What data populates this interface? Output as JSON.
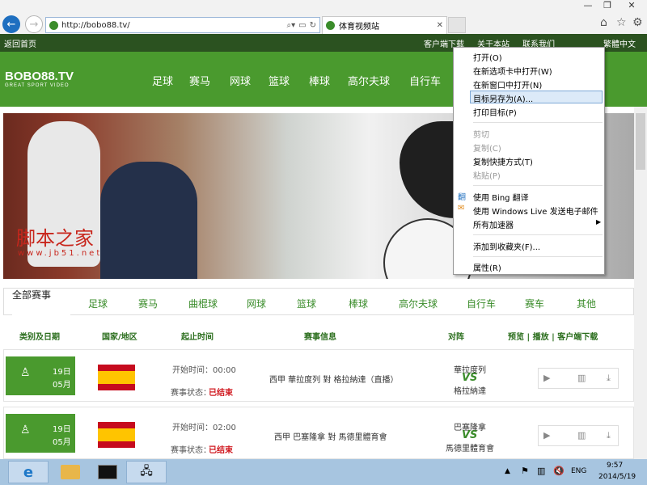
{
  "browser": {
    "url": "http://bobo88.tv/",
    "tab_title": "体育视频站",
    "fav_icon": "site-leaf-icon"
  },
  "topbar": {
    "home": "返回首页",
    "download": "客户端下载",
    "about": "关于本站",
    "contact": "联系我们",
    "lang": "繁體中文"
  },
  "site": {
    "logo": "BOBO88.TV",
    "slogan": "GREAT SPORT VIDEO",
    "nav": [
      "足球",
      "赛马",
      "网球",
      "篮球",
      "棒球",
      "高尔夫球",
      "自行车"
    ]
  },
  "banner": {
    "watermark": "脚本之家",
    "watermark_url": "www.jb51.net"
  },
  "tabs": [
    "全部赛事",
    "足球",
    "赛马",
    "曲棍球",
    "网球",
    "篮球",
    "棒球",
    "高尔夫球",
    "自行车",
    "赛车",
    "其他"
  ],
  "headers": {
    "date": "类别及日期",
    "country": "国家/地区",
    "time": "起止时间",
    "info": "赛事信息",
    "match": "对阵",
    "actions": "预览 | 播放 | 客户端下载"
  },
  "rows": [
    {
      "day": "19日",
      "month": "05月",
      "start": "开始时间：00:00",
      "status_label": "赛事状态：",
      "status": "已结束",
      "info": "西甲  華拉度列  對  格拉納達（直播）",
      "home": "華拉度列",
      "vs": "VS",
      "away": "格拉納達"
    },
    {
      "day": "19日",
      "month": "05月",
      "start": "开始时间：02:00",
      "status_label": "赛事状态：",
      "status": "已结束",
      "info": "西甲  巴塞隆拿  對  馬德里體育會",
      "home": "巴塞隆拿",
      "vs": "VS",
      "away": "馬德里體育會"
    }
  ],
  "context_menu": [
    "打开(O)",
    "在新选项卡中打开(W)",
    "在新窗口中打开(N)",
    "目标另存为(A)...",
    "打印目标(P)",
    "剪切",
    "复制(C)",
    "复制快捷方式(T)",
    "粘贴(P)",
    "使用 Bing 翻译",
    "使用 Windows Live 发送电子邮件",
    "所有加速器",
    "添加到收藏夹(F)...",
    "属性(R)"
  ],
  "taskbar": {
    "lang": "ENG",
    "time": "9:57",
    "date": "2014/5/19"
  },
  "colors": {
    "green": "#4a9a2e",
    "dark_green": "#2b5220",
    "taskbar": "#a7c5e0"
  }
}
